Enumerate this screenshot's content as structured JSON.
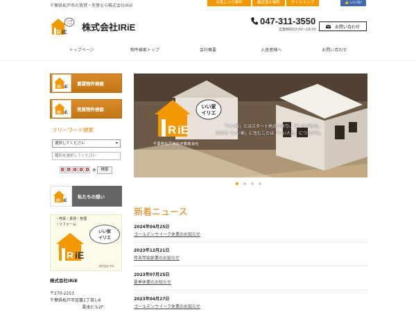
{
  "header": {
    "tagline": "千葉県松戸市の賃貸・売買なら株式会社IRiE",
    "top_links": [
      "お気に入り物件",
      "最近見た物件",
      "サイトマップ"
    ],
    "fb_like": "いいね",
    "company_name": "株式会社IRiE",
    "phone": "047-311-3550",
    "hours": "営業時間10:00～18:00",
    "contact": "お問い合わせ"
  },
  "nav": [
    "トップページ",
    "物件検索トップ",
    "会社概要",
    "入居者様へ",
    "お問い合わせ"
  ],
  "logo": {
    "text": "IRiE",
    "bubble": "いい家\nイリエ"
  },
  "sidebar": {
    "rent_search": "賃貸物件検索",
    "sale_search": "売買物件検索",
    "free_word_title": "フリーワード検索",
    "select1": "選択してください",
    "select2": "種別を選択してください",
    "counter_digits": [
      "0",
      "0",
      "0",
      "0",
      "0"
    ],
    "counter_unit": "件",
    "search_button": "検索",
    "omoi_banner": "私たちの想い",
    "ad_list": [
      "・売買・賃貸・管理",
      "・リフォーム"
    ],
    "ad_bubble": [
      "いい家",
      "イリエ"
    ],
    "ad_sub": "株式会社 IRiE",
    "company_block": {
      "name": "株式会社IRiE",
      "zip": "〒270-2253",
      "address1": "千葉県松戸市日暮1丁目1-6",
      "address2": "湯浅ビル2F"
    }
  },
  "hero": {
    "bubble": "いい家\nイリエ",
    "caption": "千葉県松戸市の不動産会社",
    "line1": "「いい家」とはスタート地点であり、ゴールである。",
    "line2": "だから「いい家」に住むことは「いい人生」につながる。",
    "slides": 4,
    "active_slide": 0
  },
  "news": {
    "title": "新着ニュース",
    "items": [
      {
        "date": "2024年04月25日",
        "title": "ゴールデンウイーク休業のお知らせ"
      },
      {
        "date": "2023年12月21日",
        "title": "年末年始休業のお知らせ"
      },
      {
        "date": "2023年07月25日",
        "title": "夏季休業のお知らせ"
      },
      {
        "date": "2023年04月27日",
        "title": "ゴールデンウイーク休業のお知らせ"
      }
    ]
  },
  "colors": {
    "accent": "#f39800",
    "news_title": "#e47c00"
  }
}
